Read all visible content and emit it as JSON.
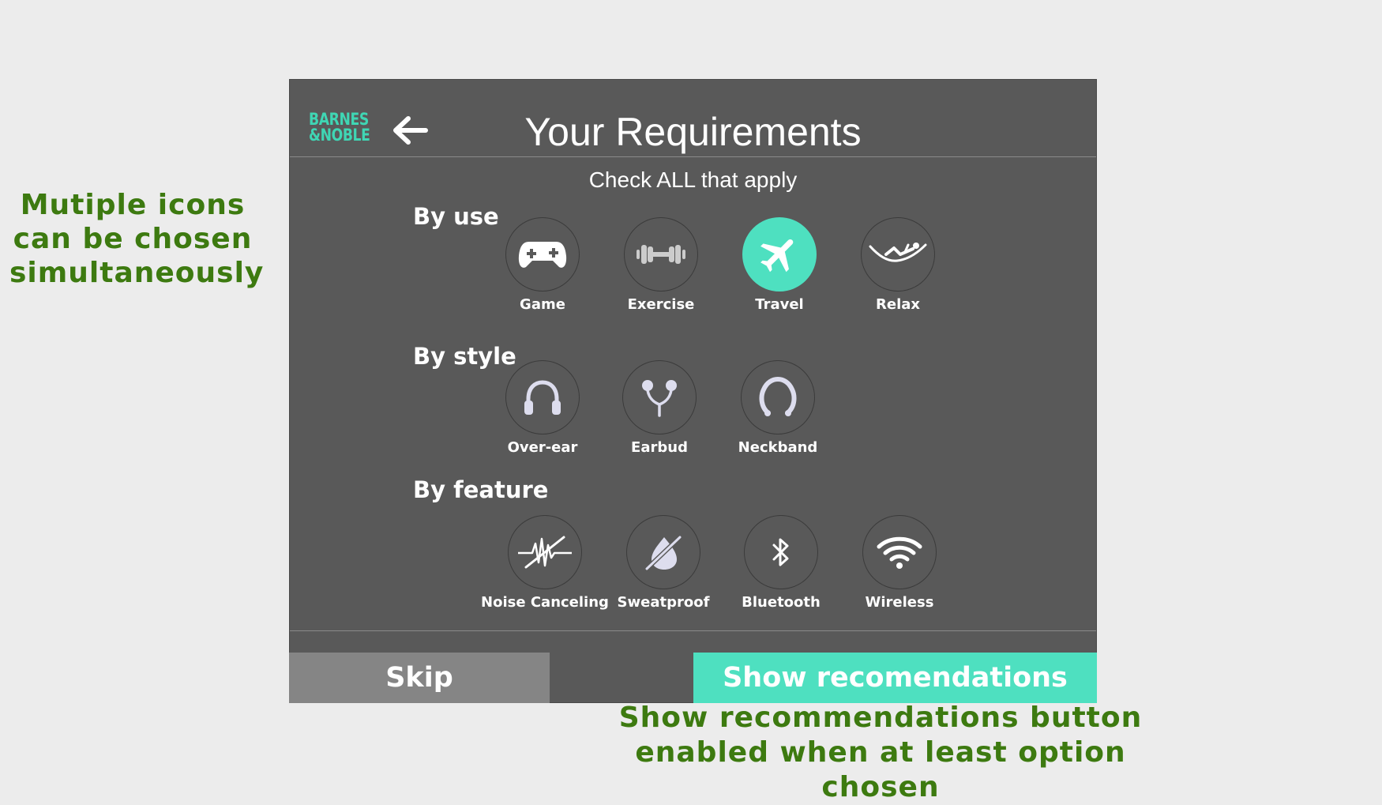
{
  "annotations": {
    "left": "Mutiple icons can be chosen simultaneously",
    "bottom": "Show recommendations button enabled when at least option chosen"
  },
  "header": {
    "logo_line1": "BARNES",
    "logo_line2": "&NOBLE",
    "title": "Your Requirements",
    "back_icon": "back-arrow-icon"
  },
  "instructions": "Check ALL that apply",
  "sections": {
    "use": {
      "title": "By use",
      "options": [
        {
          "label": "Game",
          "icon": "gamepad-icon",
          "selected": false
        },
        {
          "label": "Exercise",
          "icon": "dumbbell-icon",
          "selected": false
        },
        {
          "label": "Travel",
          "icon": "airplane-icon",
          "selected": true
        },
        {
          "label": "Relax",
          "icon": "hammock-icon",
          "selected": false
        }
      ]
    },
    "style": {
      "title": "By style",
      "options": [
        {
          "label": "Over-ear",
          "icon": "headphones-icon",
          "selected": false
        },
        {
          "label": "Earbud",
          "icon": "earbuds-icon",
          "selected": false
        },
        {
          "label": "Neckband",
          "icon": "neckband-icon",
          "selected": false
        }
      ]
    },
    "feature": {
      "title": "By feature",
      "options": [
        {
          "label": "Noise Canceling",
          "icon": "noise-canceling-icon",
          "selected": false
        },
        {
          "label": "Sweatproof",
          "icon": "sweatproof-icon",
          "selected": false
        },
        {
          "label": "Bluetooth",
          "icon": "bluetooth-icon",
          "selected": false
        },
        {
          "label": "Wireless",
          "icon": "wifi-icon",
          "selected": false
        }
      ]
    }
  },
  "footer": {
    "skip_label": "Skip",
    "show_label": "Show recomendations"
  },
  "colors": {
    "accent": "#4ee0c0",
    "panel": "#595959",
    "skip": "#858585",
    "annotation": "#3d7a10"
  }
}
